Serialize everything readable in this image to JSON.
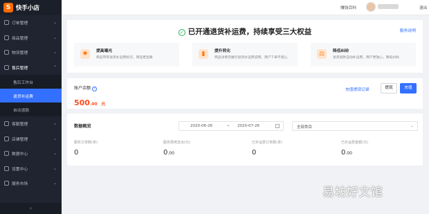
{
  "app": {
    "name": "快手小店",
    "logo_char": "S"
  },
  "sidebar": {
    "items_top": [
      {
        "label": "订单管理",
        "icon": "order-icon"
      },
      {
        "label": "商品管理",
        "icon": "goods-icon"
      },
      {
        "label": "物流管理",
        "icon": "logistics-icon"
      },
      {
        "label": "售后管理",
        "icon": "aftersale-icon"
      }
    ],
    "sub_items": [
      {
        "label": "售后工作台"
      },
      {
        "label": "退货补运费"
      },
      {
        "label": "自动退款"
      }
    ],
    "items_bottom": [
      {
        "label": "客服管理",
        "icon": "service-icon"
      },
      {
        "label": "店铺管理",
        "icon": "shop-icon"
      },
      {
        "label": "数据中心",
        "icon": "data-icon"
      },
      {
        "label": "设置中心",
        "icon": "settings-icon"
      },
      {
        "label": "服务市场",
        "icon": "market-icon"
      }
    ],
    "collapse_glyph": "‹"
  },
  "topbar": {
    "link1": "赚钱百科",
    "link2": "退出"
  },
  "hero": {
    "title": "已开通退货补运费，持续享受三大权益",
    "service_link": "服务说明",
    "benefits": [
      {
        "title": "提高曝光",
        "desc": "商品带有退货补运费标识，商品更显眼"
      },
      {
        "title": "提升转化",
        "desc": "商品详情页展示退货补运费说明，用户下单不担心"
      },
      {
        "title": "降低纠纷",
        "desc": "退货退款自动补运费，用户更放心，降低纠纷"
      }
    ]
  },
  "balance": {
    "label": "账户余额",
    "amount_int": "500",
    "amount_dec": ".00",
    "unit": "元",
    "record_link": "充值提现记录",
    "withdraw": "提现",
    "recharge": "充值"
  },
  "overview": {
    "title": "数据概览",
    "date_start": "2020-06-26",
    "date_sep": "→",
    "date_end": "2020-07-26",
    "category": "全部类目",
    "metrics": [
      {
        "label": "服务订单数(单)",
        "value": "0",
        "dec": ""
      },
      {
        "label": "服务费用支出(元)",
        "value": "0",
        "dec": ".00"
      },
      {
        "label": "已补运费订单数(单)",
        "value": "0",
        "dec": ""
      },
      {
        "label": "已补运费金额(元)",
        "value": "0",
        "dec": ".00"
      }
    ]
  },
  "watermark": "易坊好文馆",
  "colors": {
    "accent": "#3370ff",
    "sidebar_bg": "#1f2430",
    "amount": "#ff4d1f",
    "success": "#21b35a"
  }
}
